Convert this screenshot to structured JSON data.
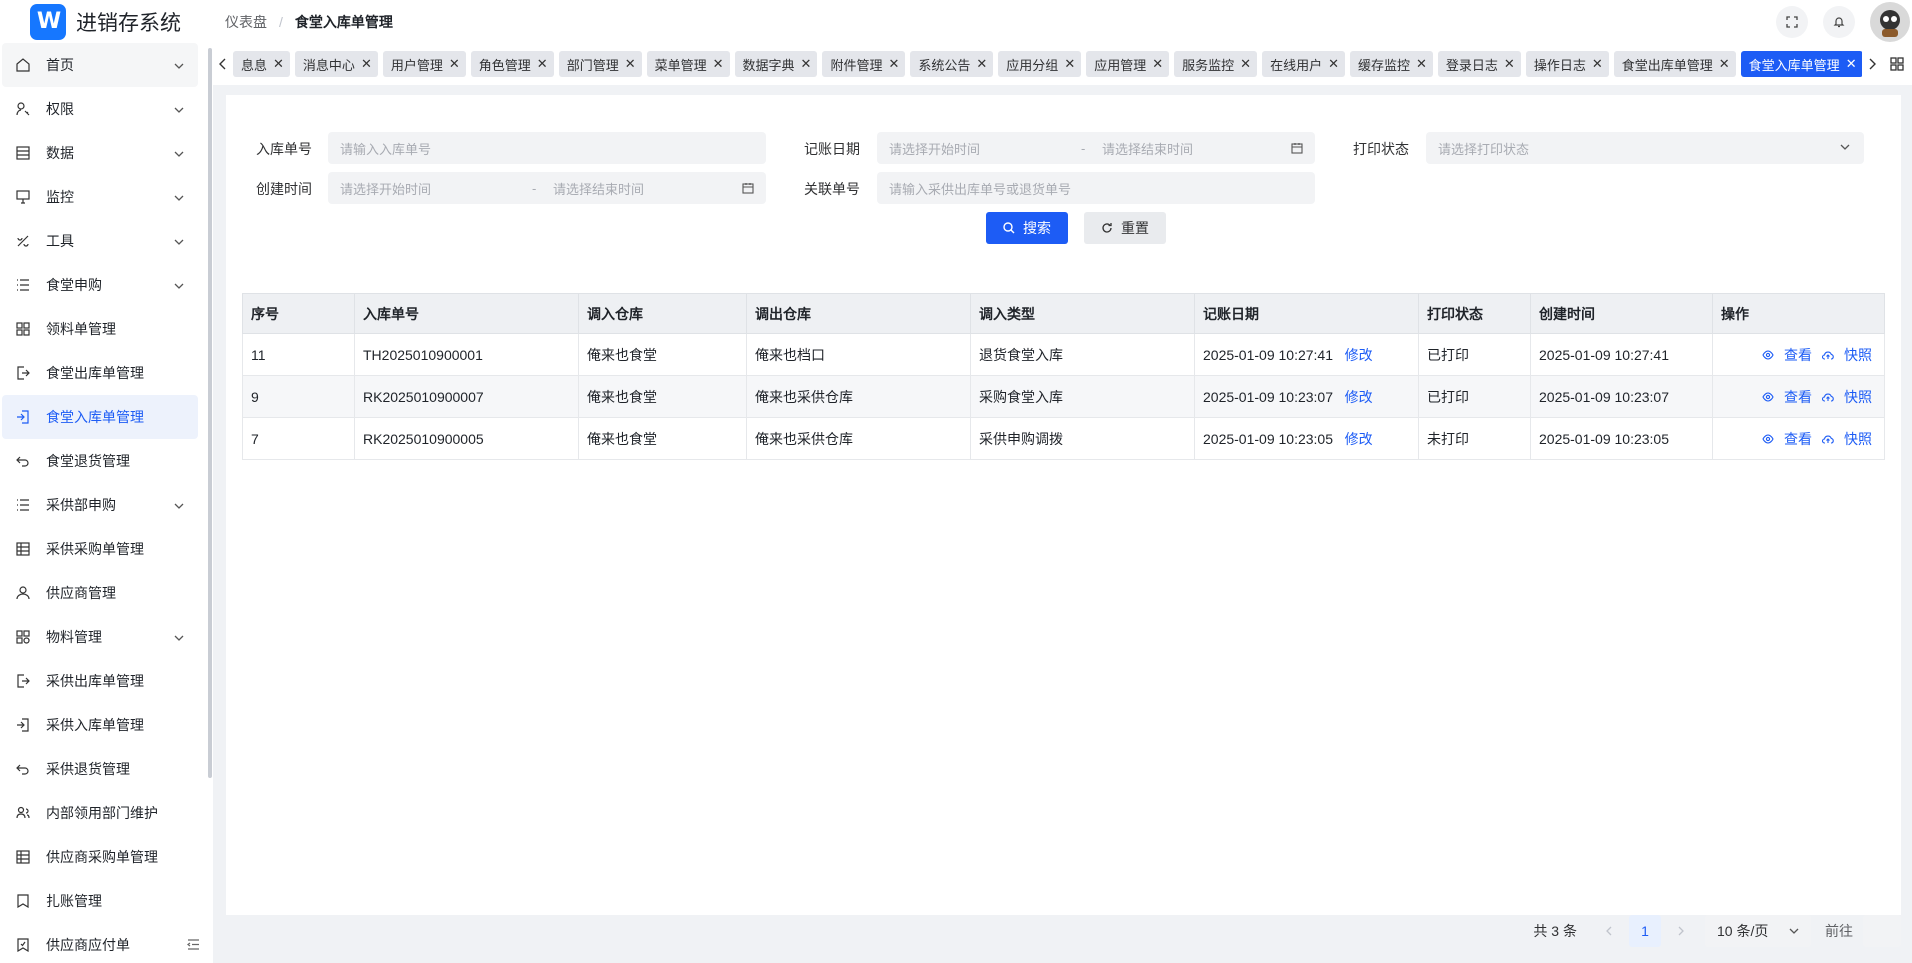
{
  "app": {
    "logo_letter": "W",
    "title": "进销存系统"
  },
  "breadcrumb": {
    "home": "仪表盘",
    "current": "食堂入库单管理"
  },
  "sidebar": {
    "items": [
      {
        "label": "首页",
        "icon": "home-icon",
        "expandable": true
      },
      {
        "label": "权限",
        "icon": "user-key-icon",
        "expandable": true
      },
      {
        "label": "数据",
        "icon": "list-icon",
        "expandable": true
      },
      {
        "label": "监控",
        "icon": "monitor-icon",
        "expandable": true
      },
      {
        "label": "工具",
        "icon": "tool-icon",
        "expandable": true
      },
      {
        "label": "食堂申购",
        "icon": "menu-list-icon",
        "expandable": true
      },
      {
        "label": "领料单管理",
        "icon": "grid-icon",
        "expandable": false
      },
      {
        "label": "食堂出库单管理",
        "icon": "export-icon",
        "expandable": false
      },
      {
        "label": "食堂入库单管理",
        "icon": "import-icon",
        "expandable": false,
        "active": true
      },
      {
        "label": "食堂退货管理",
        "icon": "undo-icon",
        "expandable": false
      },
      {
        "label": "采供部申购",
        "icon": "menu-list-icon",
        "expandable": true
      },
      {
        "label": "采供采购单管理",
        "icon": "table-icon",
        "expandable": false
      },
      {
        "label": "供应商管理",
        "icon": "user-icon",
        "expandable": false
      },
      {
        "label": "物料管理",
        "icon": "apps-icon",
        "expandable": true
      },
      {
        "label": "采供出库单管理",
        "icon": "export-icon",
        "expandable": false
      },
      {
        "label": "采供入库单管理",
        "icon": "import-icon",
        "expandable": false
      },
      {
        "label": "采供退货管理",
        "icon": "undo-icon",
        "expandable": false
      },
      {
        "label": "内部领用部门维护",
        "icon": "team-icon",
        "expandable": false
      },
      {
        "label": "供应商采购单管理",
        "icon": "table-icon",
        "expandable": false
      },
      {
        "label": "扎账管理",
        "icon": "bookmark-icon",
        "expandable": false
      },
      {
        "label": "供应商应付单",
        "icon": "bookmark-check-icon",
        "expandable": false
      }
    ]
  },
  "tabs": [
    {
      "label": "息息"
    },
    {
      "label": "消息中心"
    },
    {
      "label": "用户管理"
    },
    {
      "label": "角色管理"
    },
    {
      "label": "部门管理"
    },
    {
      "label": "菜单管理"
    },
    {
      "label": "数据字典"
    },
    {
      "label": "附件管理"
    },
    {
      "label": "系统公告"
    },
    {
      "label": "应用分组"
    },
    {
      "label": "应用管理"
    },
    {
      "label": "服务监控"
    },
    {
      "label": "在线用户"
    },
    {
      "label": "缓存监控"
    },
    {
      "label": "登录日志"
    },
    {
      "label": "操作日志"
    },
    {
      "label": "食堂出库单管理"
    },
    {
      "label": "食堂入库单管理",
      "active": true
    }
  ],
  "filters": {
    "inbound_no_label": "入库单号",
    "inbound_no_placeholder": "请输入入库单号",
    "bookkeeping_label": "记账日期",
    "start_placeholder": "请选择开始时间",
    "range_sep": "-",
    "end_placeholder": "请选择结束时间",
    "print_status_label": "打印状态",
    "print_status_placeholder": "请选择打印状态",
    "created_label": "创建时间",
    "related_no_label": "关联单号",
    "related_no_placeholder": "请输入采供出库单号或退货单号",
    "search_button": "搜索",
    "reset_button": "重置"
  },
  "table": {
    "columns": [
      "序号",
      "入库单号",
      "调入仓库",
      "调出仓库",
      "调入类型",
      "记账日期",
      "打印状态",
      "创建时间",
      "操作"
    ],
    "rows": [
      {
        "seq": "11",
        "no": "TH2025010900001",
        "in_wh": "俺来也食堂",
        "out_wh": "俺来也档口",
        "type": "退货食堂入库",
        "date": "2025-01-09 10:27:41",
        "edit": "修改",
        "print": "已打印",
        "created": "2025-01-09 10:27:41"
      },
      {
        "seq": "9",
        "no": "RK2025010900007",
        "in_wh": "俺来也食堂",
        "out_wh": "俺来也采供仓库",
        "type": "采购食堂入库",
        "date": "2025-01-09 10:23:07",
        "edit": "修改",
        "print": "已打印",
        "created": "2025-01-09 10:23:07"
      },
      {
        "seq": "7",
        "no": "RK2025010900005",
        "in_wh": "俺来也食堂",
        "out_wh": "俺来也采供仓库",
        "type": "采供申购调拨",
        "date": "2025-01-09 10:23:05",
        "edit": "修改",
        "print": "未打印",
        "created": "2025-01-09 10:23:05"
      }
    ],
    "view_label": "查看",
    "photo_label": "快照"
  },
  "pagination": {
    "total": "共 3 条",
    "current_page": "1",
    "page_size": "10 条/页",
    "goto": "前往"
  },
  "colors": {
    "primary": "#1d5cf5",
    "active_bg": "#edf2fc",
    "tab_bg": "#e4e6eb"
  }
}
